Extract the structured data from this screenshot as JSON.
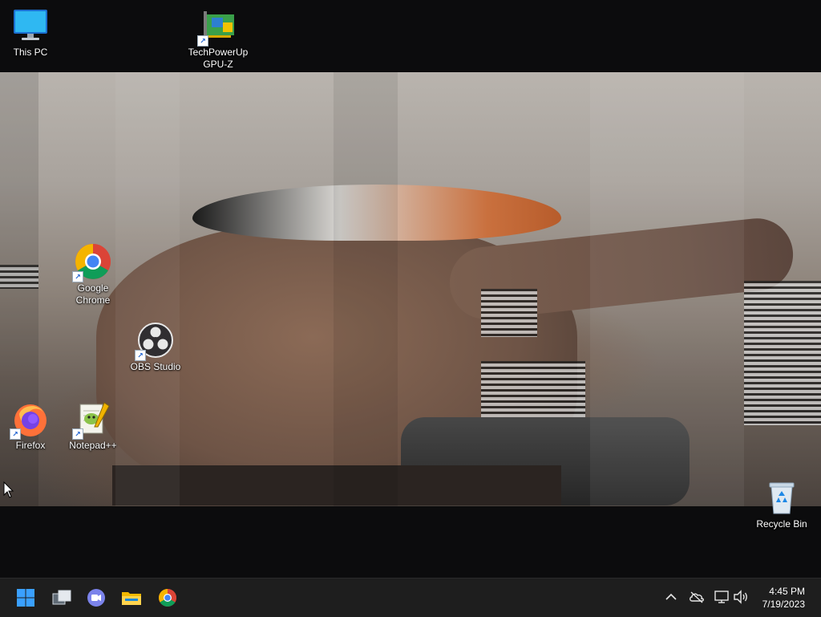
{
  "desktop_icons": {
    "this_pc": "This PC",
    "gpuz": "TechPowerUp GPU-Z",
    "chrome": "Google Chrome",
    "obs": "OBS Studio",
    "firefox": "Firefox",
    "notepadpp": "Notepad++",
    "recycle_bin": "Recycle Bin"
  },
  "taskbar": {
    "pinned": [
      "start",
      "task-view",
      "teams-chat",
      "file-explorer",
      "google-chrome"
    ],
    "tray_icons": [
      "show-hidden-icons",
      "onedrive",
      "network",
      "volume"
    ]
  },
  "clock": {
    "time": "4:45 PM",
    "date": "7/19/2023"
  },
  "colors": {
    "taskbar_bg": "#1e1e1e",
    "desktop_bg": "#0c0c0d",
    "windows_blue": "#1e8fff"
  }
}
